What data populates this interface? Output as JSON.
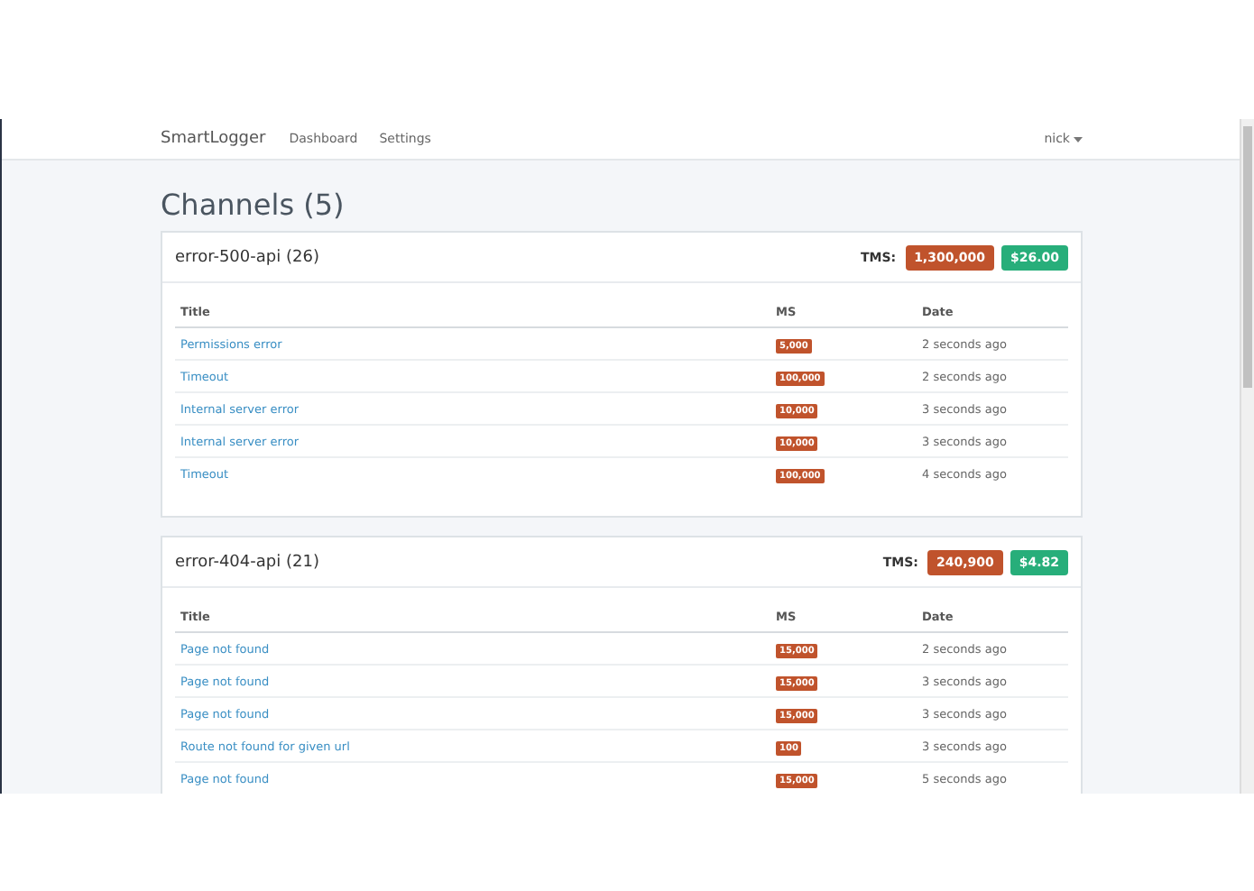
{
  "navbar": {
    "brand": "SmartLogger",
    "links": [
      "Dashboard",
      "Settings"
    ],
    "user": "nick"
  },
  "heading": "Channels (5)",
  "channels": [
    {
      "name": "error-500-api (26)",
      "tms_label": "TMS:",
      "tms": "1,300,000",
      "cost": "$26.00",
      "columns": [
        "Title",
        "MS",
        "Date"
      ],
      "rows": [
        {
          "title": "Permissions error",
          "ms": "5,000",
          "date": "2 seconds ago"
        },
        {
          "title": "Timeout",
          "ms": "100,000",
          "date": "2 seconds ago"
        },
        {
          "title": "Internal server error",
          "ms": "10,000",
          "date": "3 seconds ago"
        },
        {
          "title": "Internal server error",
          "ms": "10,000",
          "date": "3 seconds ago"
        },
        {
          "title": "Timeout",
          "ms": "100,000",
          "date": "4 seconds ago"
        }
      ]
    },
    {
      "name": "error-404-api (21)",
      "tms_label": "TMS:",
      "tms": "240,900",
      "cost": "$4.82",
      "columns": [
        "Title",
        "MS",
        "Date"
      ],
      "rows": [
        {
          "title": "Page not found",
          "ms": "15,000",
          "date": "2 seconds ago"
        },
        {
          "title": "Page not found",
          "ms": "15,000",
          "date": "3 seconds ago"
        },
        {
          "title": "Page not found",
          "ms": "15,000",
          "date": "3 seconds ago"
        },
        {
          "title": "Route not found for given url",
          "ms": "100",
          "date": "3 seconds ago"
        },
        {
          "title": "Page not found",
          "ms": "15,000",
          "date": "5 seconds ago"
        }
      ]
    }
  ]
}
